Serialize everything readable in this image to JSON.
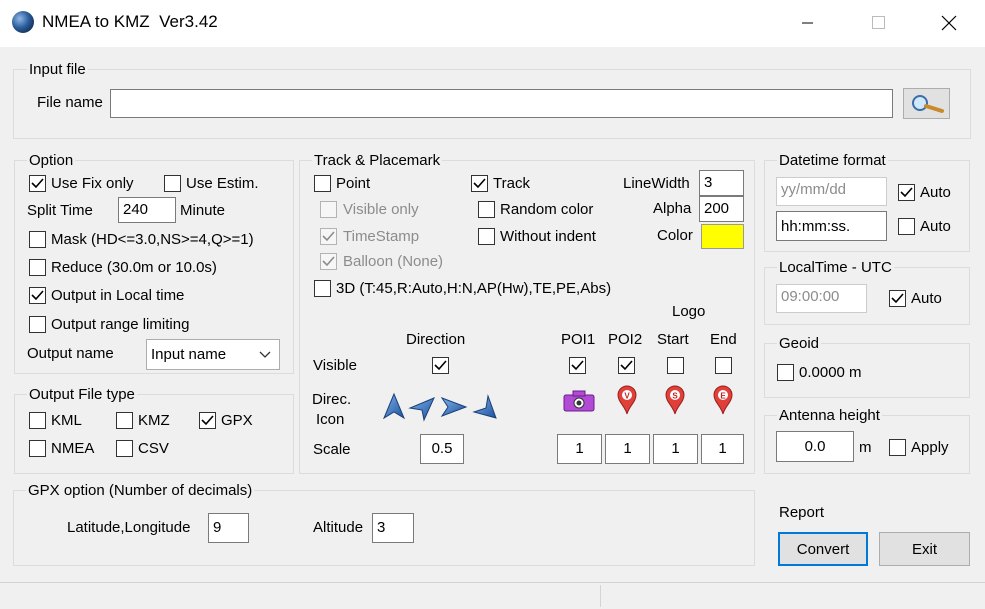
{
  "window": {
    "title": "NMEA to KMZ  Ver3.42"
  },
  "input_file": {
    "legend": "Input file",
    "file_name_label": "File name",
    "file_name_value": ""
  },
  "option": {
    "legend": "Option",
    "use_fix_only": {
      "label": "Use Fix only",
      "checked": true
    },
    "use_estim": {
      "label": "Use Estim.",
      "checked": false
    },
    "split_time_label": "Split Time",
    "split_time_value": "240",
    "minute_label": "Minute",
    "mask": {
      "label": "Mask (HD<=3.0,NS>=4,Q>=1)",
      "checked": false
    },
    "reduce": {
      "label": "Reduce (30.0m or 10.0s)",
      "checked": false
    },
    "output_local_time": {
      "label": "Output in Local time",
      "checked": true
    },
    "output_range": {
      "label": "Output range limiting",
      "checked": false
    },
    "output_name_label": "Output name",
    "output_name_value": "Input name"
  },
  "output_file_type": {
    "legend": "Output File type",
    "kml": {
      "label": "KML",
      "checked": false
    },
    "kmz": {
      "label": "KMZ",
      "checked": false
    },
    "gpx": {
      "label": "GPX",
      "checked": true
    },
    "nmea": {
      "label": "NMEA",
      "checked": false
    },
    "csv": {
      "label": "CSV",
      "checked": false
    }
  },
  "track": {
    "legend": "Track & Placemark",
    "point": {
      "label": "Point",
      "checked": false
    },
    "visible_only": {
      "label": "Visible only",
      "checked": false
    },
    "timestamp": {
      "label": "TimeStamp",
      "checked": true
    },
    "balloon": {
      "label": "Balloon (None)",
      "checked": true
    },
    "track": {
      "label": "Track",
      "checked": true
    },
    "random_color": {
      "label": "Random color",
      "checked": false
    },
    "without_indent": {
      "label": "Without indent",
      "checked": false
    },
    "linewidth_label": "LineWidth",
    "linewidth_value": "3",
    "alpha_label": "Alpha",
    "alpha_value": "200",
    "color_label": "Color",
    "color_value": "#ffff00",
    "three_d": {
      "label": "3D (T:45,R:Auto,H:N,AP(Hw),TE,PE,Abs)",
      "checked": false
    },
    "logo_label": "Logo",
    "direction_label": "Direction",
    "poi1_label": "POI1",
    "poi2_label": "POI2",
    "start_label": "Start",
    "end_label": "End",
    "visible_label": "Visible",
    "direction_visible": true,
    "poi1_visible": true,
    "poi2_visible": true,
    "start_visible": false,
    "end_visible": false,
    "direc_icon_label_1": "Direc.",
    "direc_icon_label_2": "Icon",
    "scale_label": "Scale",
    "direction_scale": "0.5",
    "poi1_scale": "1",
    "poi2_scale": "1",
    "start_scale": "1",
    "end_scale": "1",
    "marker_letters": {
      "poi2": "V",
      "start": "S",
      "end": "E"
    }
  },
  "datetime_format": {
    "legend": "Datetime format",
    "date_placeholder": "yy/mm/dd",
    "date_auto": {
      "label": "Auto",
      "checked": true
    },
    "time_value": "hh:mm:ss.",
    "time_auto": {
      "label": "Auto",
      "checked": false
    }
  },
  "localtime": {
    "legend": "LocalTime - UTC",
    "value": "09:00:00",
    "auto": {
      "label": "Auto",
      "checked": true
    }
  },
  "geoid": {
    "legend": "Geoid",
    "checkbox": {
      "label": "0.0000 m",
      "checked": false
    }
  },
  "antenna": {
    "legend": "Antenna height",
    "value": "0.0",
    "unit": "m",
    "apply": {
      "label": "Apply",
      "checked": false
    }
  },
  "gpx_option": {
    "legend": "GPX option (Number of decimals)",
    "latlon_label": "Latitude,Longitude",
    "latlon_value": "9",
    "altitude_label": "Altitude",
    "altitude_value": "3"
  },
  "actions": {
    "report_label": "Report",
    "convert_label": "Convert",
    "exit_label": "Exit"
  }
}
